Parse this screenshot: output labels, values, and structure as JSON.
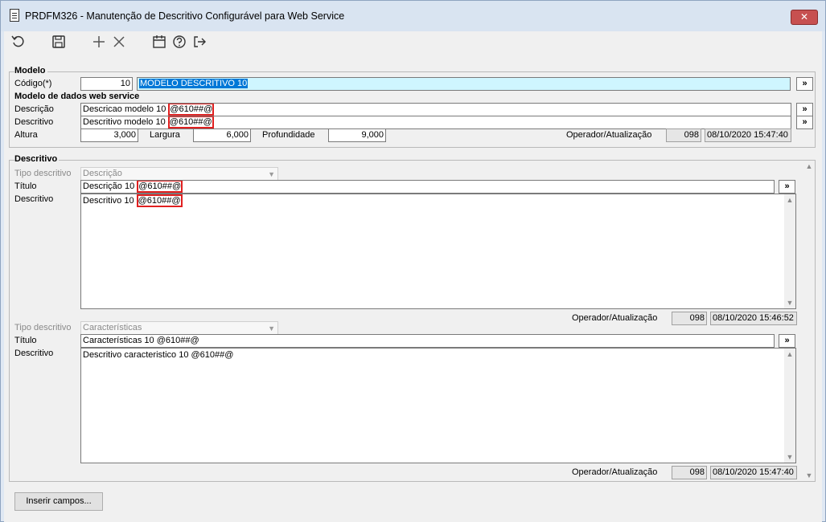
{
  "window": {
    "title": "PRDFM326 - Manutenção de Descritivo Configurável para Web Service",
    "close_label": "✕"
  },
  "toolbar": {
    "icons": [
      "refresh-icon",
      "save-icon",
      "add-icon",
      "delete-icon",
      "calendar-icon",
      "help-icon",
      "exit-icon"
    ]
  },
  "modelo": {
    "legend": "Modelo",
    "codigo_label": "Código(*)",
    "codigo_value": "10",
    "nome_value": "MODELO DESCRITIVO 10",
    "more_label": "»"
  },
  "ws": {
    "legend": "Modelo de dados web service",
    "descricao_label": "Descrição",
    "descricao_value_a": "Descricao modelo 10 ",
    "descricao_value_b": "@610##@",
    "descritivo_label": "Descritivo",
    "descritivo_value_a": "Descritivo modelo 10 ",
    "descritivo_value_b": "@610##@",
    "altura_label": "Altura",
    "altura_value": "3,000",
    "largura_label": "Largura",
    "largura_value": "6,000",
    "profundidade_label": "Profundidade",
    "profundidade_value": "9,000",
    "operador_label": "Operador/Atualização",
    "operador_value": "098",
    "data_value": "08/10/2020 15:47:40",
    "more_label": "»"
  },
  "descritivo": {
    "legend": "Descritivo",
    "blocks": [
      {
        "tipo_label": "Tipo descritivo",
        "tipo_value": "Descrição",
        "titulo_label": "Título",
        "titulo_value_a": "Descrição 10 ",
        "titulo_value_b": "@610##@",
        "descritivo_label": "Descritivo",
        "descritivo_value_a": "Descritivo 10 ",
        "descritivo_value_b": "@610##@",
        "operador_label": "Operador/Atualização",
        "operador_value": "098",
        "data_value": "08/10/2020 15:46:52"
      },
      {
        "tipo_label": "Tipo descritivo",
        "tipo_value": "Características",
        "titulo_label": "Título",
        "titulo_value": "Características 10 @610##@",
        "descritivo_label": "Descritivo",
        "descritivo_value": "Descritivo caracteristico 10 @610##@",
        "operador_label": "Operador/Atualização",
        "operador_value": "098",
        "data_value": "08/10/2020 15:47:40"
      }
    ],
    "more_label": "»"
  },
  "footer": {
    "inserir_label": "Inserir campos..."
  }
}
